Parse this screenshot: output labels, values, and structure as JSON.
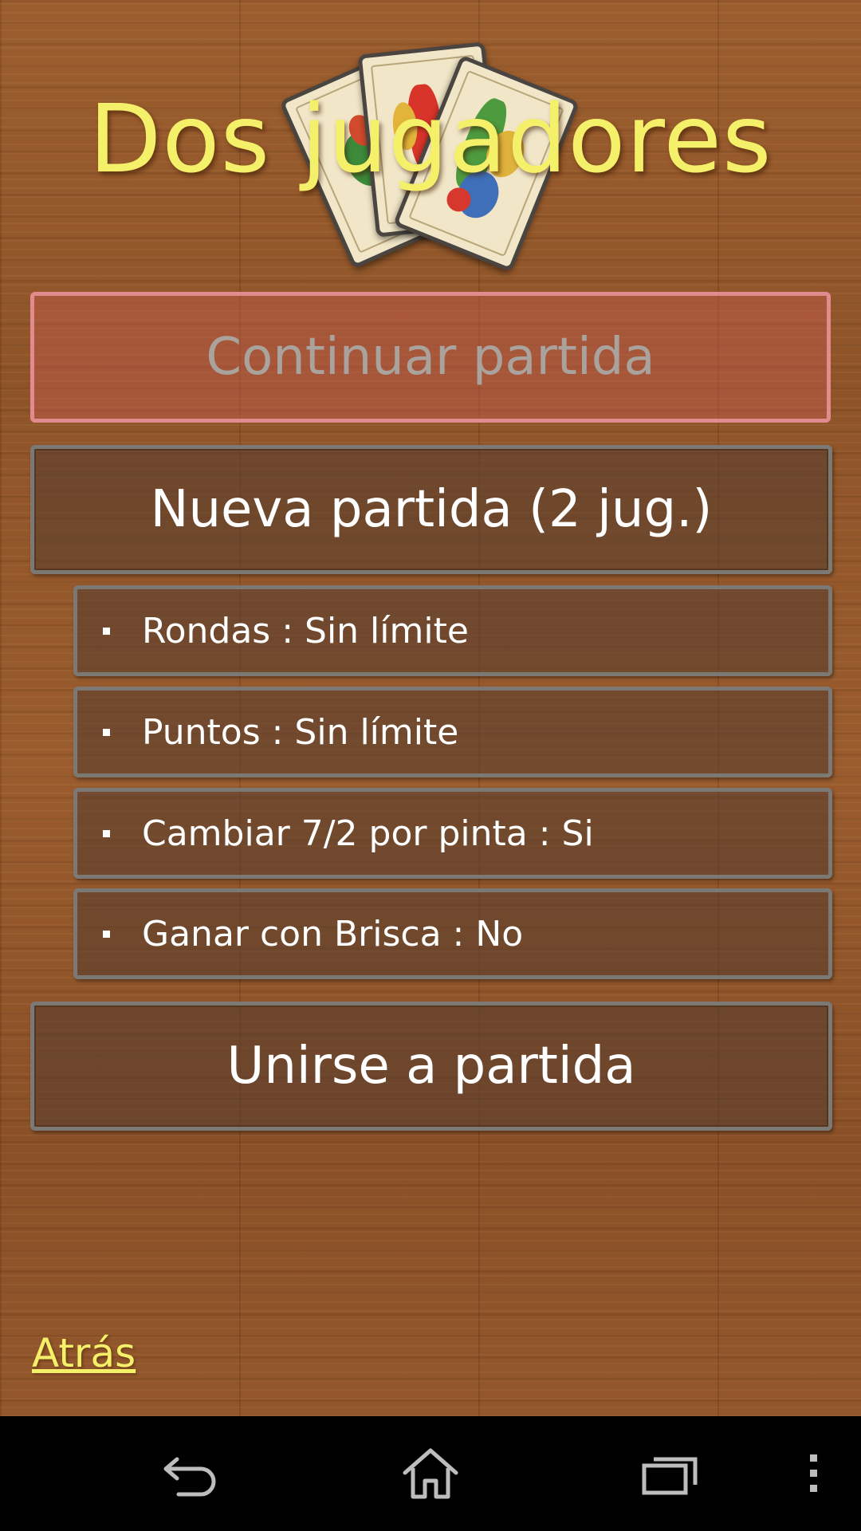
{
  "title": "Dos jugadores",
  "buttons": {
    "continue": "Continuar partida",
    "new_game": "Nueva partida (2 jug.)",
    "join": "Unirse a partida"
  },
  "options": [
    {
      "label": "Rondas : Sin límite"
    },
    {
      "label": "Puntos : Sin límite"
    },
    {
      "label": "Cambiar 7/2 por pinta : Si"
    },
    {
      "label": "Ganar con Brisca : No"
    }
  ],
  "back_link": "Atrás",
  "navbar": {
    "icons": [
      "back-icon",
      "home-icon",
      "recent-apps-icon",
      "overflow-menu-icon"
    ]
  },
  "colors": {
    "title": "#f5f06a",
    "continue_border": "#e08c8e",
    "button_border": "#7c7874"
  }
}
